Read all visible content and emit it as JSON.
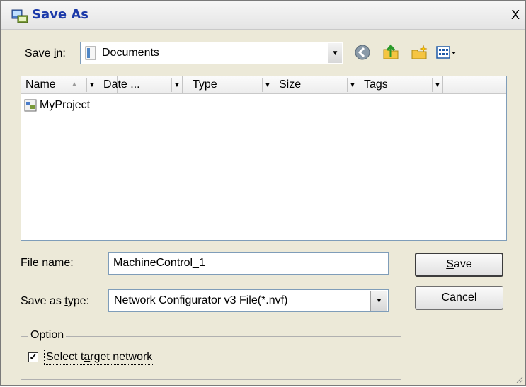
{
  "window": {
    "title": "Save As",
    "close_glyph": "X"
  },
  "save_in": {
    "label": "Save in:",
    "value": "Documents"
  },
  "toolbar": {
    "icons": [
      "back-icon",
      "up-folder-icon",
      "new-folder-icon",
      "view-menu-icon"
    ]
  },
  "columns": [
    {
      "label": "Name"
    },
    {
      "label": "Date ..."
    },
    {
      "label": "Type"
    },
    {
      "label": "Size"
    },
    {
      "label": "Tags"
    }
  ],
  "files": [
    {
      "name": "MyProject"
    }
  ],
  "file_name": {
    "label": "File name:",
    "value": "MachineControl_1"
  },
  "save_as_type": {
    "label": "Save as type:",
    "value": "Network Configurator v3 File(*.nvf)"
  },
  "buttons": {
    "save": "Save",
    "cancel": "Cancel"
  },
  "option": {
    "group_title": "Option",
    "checkbox_label": "Select target network",
    "checked": true
  },
  "colors": {
    "title_text": "#1c3aa9",
    "dialog_bg": "#ece9d8",
    "field_border": "#7f9db9"
  }
}
